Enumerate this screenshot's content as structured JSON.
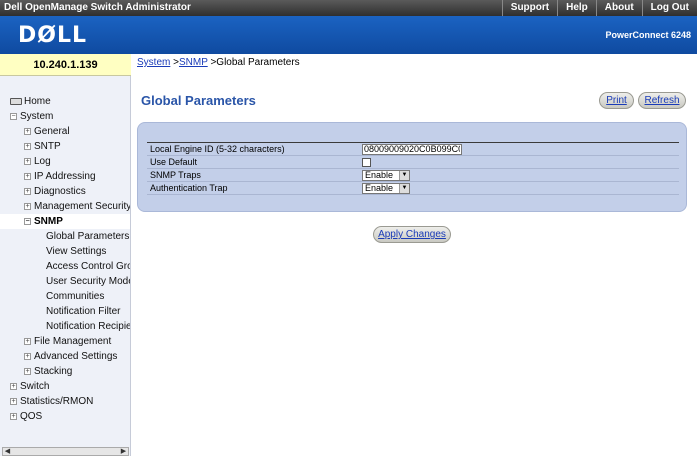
{
  "top_bar": {
    "app_title": "Dell OpenManage Switch Administrator",
    "links": [
      "Support",
      "Help",
      "About",
      "Log Out"
    ]
  },
  "banner": {
    "logo": "DØLL",
    "model": "PowerConnect 6248"
  },
  "sidebar": {
    "ip_address": "10.240.1.139",
    "tree": {
      "home": "Home",
      "system": "System",
      "general": "General",
      "sntp": "SNTP",
      "log": "Log",
      "ip_addressing": "IP Addressing",
      "diagnostics": "Diagnostics",
      "management_security": "Management Security",
      "snmp": "SNMP",
      "global_parameters": "Global Parameters",
      "view_settings": "View Settings",
      "access_control_group": "Access Control Grou",
      "user_security_model": "User Security Model",
      "communities": "Communities",
      "notification_filter": "Notification Filter",
      "notification_recipient": "Notification Recipient",
      "file_management": "File Management",
      "advanced_settings": "Advanced Settings",
      "stacking": "Stacking",
      "switch": "Switch",
      "statistics_rmon": "Statistics/RMON",
      "qos": "QOS"
    }
  },
  "breadcrumb": {
    "system": "System",
    "sep1": " >",
    "snmp": "SNMP",
    "current": " >Global Parameters"
  },
  "page": {
    "title": "Global Parameters",
    "print_label": "Print",
    "refresh_label": "Refresh",
    "apply_label": "Apply Changes"
  },
  "form": {
    "local_engine_id_label": "Local Engine ID (5-32 characters)",
    "local_engine_id_value": "08009009020C0B099C0",
    "use_default_label": "Use Default",
    "use_default_checked": false,
    "snmp_traps_label": "SNMP Traps",
    "snmp_traps_value": "Enable",
    "auth_trap_label": "Authentication Trap",
    "auth_trap_value": "Enable"
  }
}
